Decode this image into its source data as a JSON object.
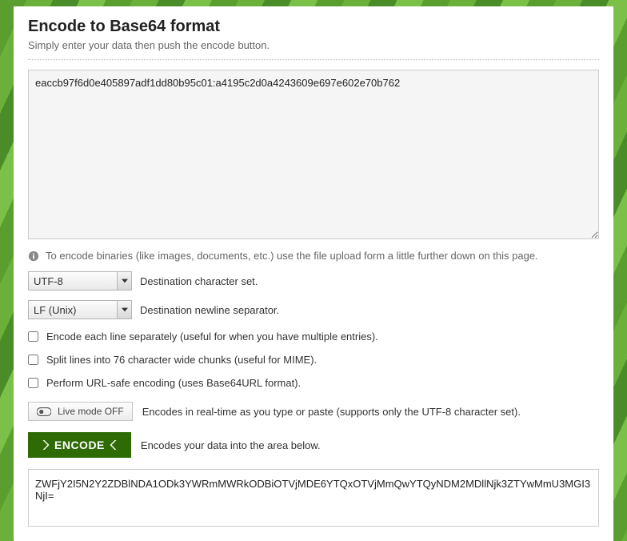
{
  "header": {
    "title": "Encode to Base64 format",
    "subtitle": "Simply enter your data then push the encode button."
  },
  "input": {
    "value": "eaccb97f6d0e405897adf1dd80b95c01:a4195c2d0a4243609e697e602e70b762"
  },
  "hint": "To encode binaries (like images, documents, etc.) use the file upload form a little further down on this page.",
  "charset": {
    "selected": "UTF-8",
    "label": "Destination character set."
  },
  "newline": {
    "selected": "LF (Unix)",
    "label": "Destination newline separator."
  },
  "checks": {
    "eachline": "Encode each line separately (useful for when you have multiple entries).",
    "split76": "Split lines into 76 character wide chunks (useful for MIME).",
    "urlsafe": "Perform URL-safe encoding (uses Base64URL format)."
  },
  "live": {
    "button": "Live mode OFF",
    "desc": "Encodes in real-time as you type or paste (supports only the UTF-8 character set)."
  },
  "encode": {
    "button": "ENCODE",
    "desc": "Encodes your data into the area below."
  },
  "output": {
    "value": "ZWFjY2I5N2Y2ZDBlNDA1ODk3YWRmMWRkODBiOTVjMDE6YTQxOTVjMmQwYTQyNDM2MDllNjk3ZTYwMmU3MGI3NjI="
  }
}
